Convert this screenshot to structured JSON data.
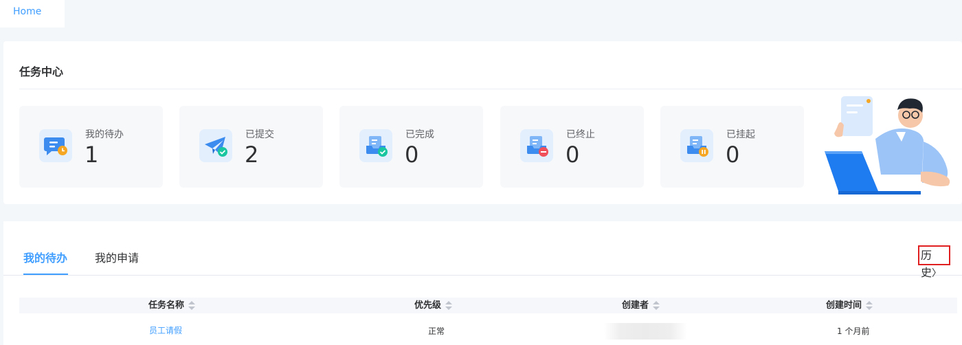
{
  "tabs": {
    "home": "Home"
  },
  "task_center": {
    "title": "任务中心",
    "cards": [
      {
        "label": "我的待办",
        "count": "1",
        "icon": "todo-chat-clock-icon"
      },
      {
        "label": "已提交",
        "count": "2",
        "icon": "paper-plane-check-icon"
      },
      {
        "label": "已完成",
        "count": "0",
        "icon": "inbox-check-icon"
      },
      {
        "label": "已终止",
        "count": "0",
        "icon": "inbox-minus-icon"
      },
      {
        "label": "已挂起",
        "count": "0",
        "icon": "inbox-pause-icon"
      }
    ]
  },
  "todo_panel": {
    "tabs": [
      "我的待办",
      "我的申请"
    ],
    "active_tab": "我的待办",
    "history_label": "历史",
    "columns": [
      "任务名称",
      "优先级",
      "创建者",
      "创建时间"
    ],
    "rows": [
      {
        "name": "员工请假",
        "priority": "正常",
        "creator": "",
        "created": "1 个月前"
      }
    ]
  },
  "colors": {
    "accent": "#409eff",
    "highlight_border": "#e02020"
  }
}
